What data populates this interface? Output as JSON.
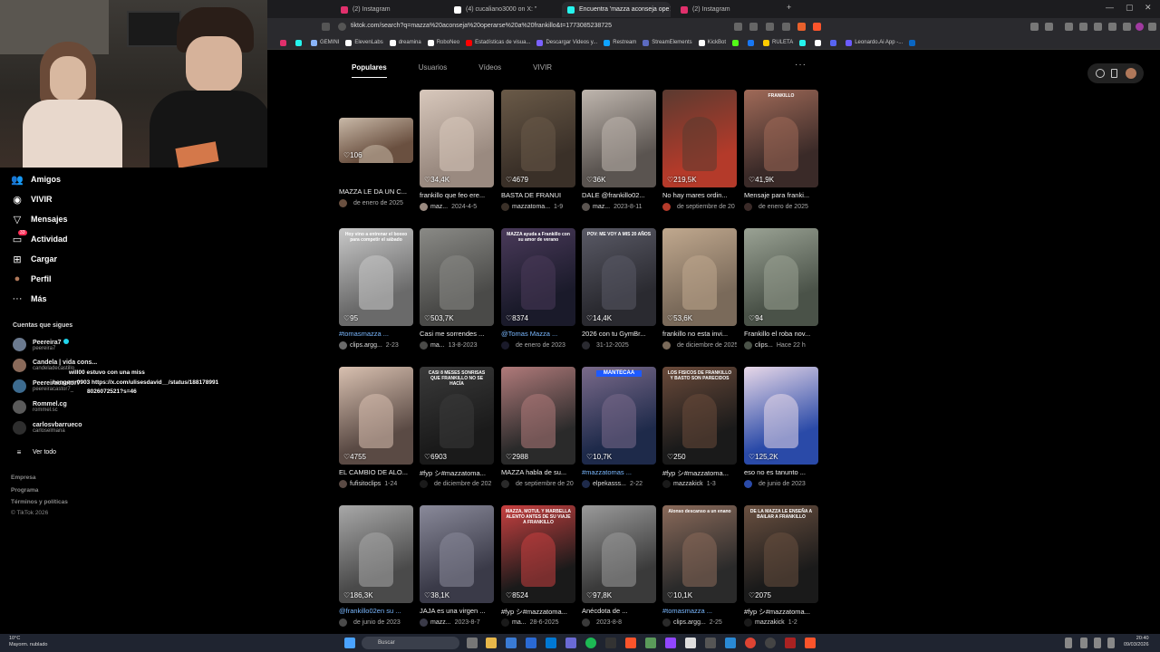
{
  "browser": {
    "tabs": [
      {
        "label": "(2) Instagram",
        "color": "#e1306c",
        "active": false
      },
      {
        "label": "(4) cucaliano3000 on X: \"",
        "color": "#ffffff",
        "active": false
      },
      {
        "label": "Encuentra 'mazza aconseja ope",
        "color": "#25f4ee",
        "active": true
      },
      {
        "label": "(2) Instagram",
        "color": "#e1306c",
        "active": false
      }
    ],
    "new_tab": "+",
    "url": "tiktok.com/search?q=mazza%20aconseja%20operarse%20a%20frankillo&t=1773085238725",
    "bookmarks": [
      {
        "label": "GEMINI",
        "color": "#8ab4f8"
      },
      {
        "label": "ElevenLabs",
        "color": "#ffffff"
      },
      {
        "label": "dreamina",
        "color": "#ffffff"
      },
      {
        "label": "RoboNeo",
        "color": "#ffffff"
      },
      {
        "label": "Estadísticas de visua...",
        "color": "#ff0000"
      },
      {
        "label": "Descargar Videos y...",
        "color": "#7b61ff"
      },
      {
        "label": "Restream",
        "color": "#0fa3ff"
      },
      {
        "label": "StreamElements",
        "color": "#5c6bc0"
      },
      {
        "label": "KickBot",
        "color": "#ffffff"
      },
      {
        "label": "RULETA",
        "color": "#ffcc00"
      },
      {
        "label": "Leonardo.Ai App -...",
        "color": "#6b5bff"
      }
    ]
  },
  "sidebar": {
    "items": [
      {
        "label": "Amigos",
        "icon": "friends-icon",
        "glyph": "👥"
      },
      {
        "label": "VIVIR",
        "icon": "live-icon",
        "glyph": "◉"
      },
      {
        "label": "Mensajes",
        "icon": "messages-icon",
        "glyph": "▽"
      },
      {
        "label": "Actividad",
        "icon": "activity-icon",
        "glyph": "▭"
      },
      {
        "label": "Cargar",
        "icon": "upload-icon",
        "glyph": "⊞"
      },
      {
        "label": "Perfil",
        "icon": "profile-icon",
        "glyph": "●"
      },
      {
        "label": "Más",
        "icon": "more-icon",
        "glyph": "···"
      }
    ],
    "actividad_badge": "33",
    "following_title": "Cuentas que sigues",
    "following": [
      {
        "name": "Peereira7",
        "handle": "peereira7",
        "verified": true,
        "color": "#6b7a8f"
      },
      {
        "name": "Candela | vida cons...",
        "handle": "candeladecastillo",
        "verified": false,
        "color": "#8a6a5a"
      },
      {
        "name": "Peereiracastor7",
        "handle": "peereiracastor7_",
        "verified": false,
        "color": "#3d6b8f"
      },
      {
        "name": "Rommel.cg",
        "handle": "rommel.sc",
        "verified": false,
        "color": "#5a5a5a"
      },
      {
        "name": "carlosvbarrueco",
        "handle": "carloselmana",
        "verified": false,
        "color": "#2e2e2e"
      }
    ],
    "see_all": "Ver todo",
    "footer": [
      "Empresa",
      "Programa",
      "Términos y políticas",
      "© TikTok 2026"
    ]
  },
  "chat_overlay": [
    "will00  estuvo con una miss",
    "hengerrr0903  https://x.com/ulisesdavid__/status/188178991",
    "8026072521?s=46"
  ],
  "content": {
    "tabs": [
      "Populares",
      "Usuarios",
      "Vídeos",
      "VIVIR"
    ],
    "active_tab": "Populares",
    "videos": [
      {
        "likes": "106",
        "desc": "MAZZA LE DA UN C...",
        "author": "",
        "date": "de enero de 2025",
        "c1": "#6a5040",
        "c2": "#c9b9a8",
        "overlay": "",
        "tag": false
      },
      {
        "likes": "34,4K",
        "desc": "frankillo que feo ere...",
        "author": "maz...",
        "date": "2024-4-5",
        "c1": "#9a8a80",
        "c2": "#d8c8bc",
        "overlay": "",
        "tag": false
      },
      {
        "likes": "4679",
        "desc": "BASTA DE FRANUI",
        "author": "mazzatoma...",
        "date": "1-9",
        "c1": "#3a3028",
        "c2": "#6a5a48",
        "overlay": "",
        "tag": false
      },
      {
        "likes": "36K",
        "desc": "DALE @frankillo02...",
        "author": "maz...",
        "date": "2023-8-11",
        "c1": "#5a5450",
        "c2": "#bfb6ae",
        "overlay": "",
        "tag": false
      },
      {
        "likes": "219,5K",
        "desc": "No hay mares ordin...",
        "author": "",
        "date": "de septiembre de 20",
        "c1": "#b43a2a",
        "c2": "#5a3a30",
        "overlay": "",
        "tag": false
      },
      {
        "likes": "41,9K",
        "desc": "Mensaje para franki...",
        "author": "",
        "date": "de enero de 2025",
        "c1": "#3a2a28",
        "c2": "#a06a58",
        "overlay": "FRANKILLO",
        "tag": false
      },
      {
        "likes": "95",
        "desc": "#tomasmazza ...",
        "author": "clips.argg...",
        "date": "2-23",
        "c1": "#6a6a6a",
        "c2": "#c8c8c8",
        "overlay": "Hoy vino a entrenar el boxeo para competir el sábado",
        "tag": true
      },
      {
        "likes": "503,7K",
        "desc": "Casi me sorrendes ...",
        "author": "ma...",
        "date": "13-8-2023",
        "c1": "#4a4a48",
        "c2": "#8a8a86",
        "overlay": "",
        "tag": false
      },
      {
        "likes": "8374",
        "desc": "@Tomas Mazza ...",
        "author": "",
        "date": "de enero de 2023",
        "c1": "#1a1a2a",
        "c2": "#4a3a5a",
        "overlay": "MAZZA ayuda a Frankillo con su amor de verano",
        "tag": true
      },
      {
        "likes": "14,4K",
        "desc": "2026 con tu GymBr...",
        "author": "",
        "date": "31-12-2025",
        "c1": "#2a2a30",
        "c2": "#5a5a66",
        "overlay": "POV: ME VOY A MIS 20 AÑOS",
        "tag": false
      },
      {
        "likes": "53,6K",
        "desc": "frankillo no esta invi...",
        "author": "",
        "date": "de diciembre de 2025",
        "c1": "#7a6a5a",
        "c2": "#c0a88e",
        "overlay": "",
        "tag": false
      },
      {
        "likes": "94",
        "desc": "Frankillo el roba nov...",
        "author": "clips...",
        "date": "Hace 22 h",
        "c1": "#4a5248",
        "c2": "#9aa294",
        "overlay": "",
        "tag": false
      },
      {
        "likes": "4755",
        "desc": "EL CAMBIO DE ALO...",
        "author": "fufisitoclips",
        "date": "1-24",
        "c1": "#5a4a44",
        "c2": "#d8c0b0",
        "overlay": "",
        "tag": false
      },
      {
        "likes": "6903",
        "desc": "#fyp シ#mazzatoma...",
        "author": "",
        "date": "de diciembre de 202",
        "c1": "#1a1a1a",
        "c2": "#3a3a3a",
        "overlay": "CASI 8 MESES SONRISAS QUE FRANKILLO NO SE HACÍA",
        "tag": false
      },
      {
        "likes": "2988",
        "desc": "MAZZA habla de su...",
        "author": "",
        "date": "de septiembre de 20",
        "c1": "#2a2a2a",
        "c2": "#b07a7a",
        "overlay": "",
        "tag": false
      },
      {
        "likes": "10,7K",
        "desc": "#mazzatomas ...",
        "author": "elpekasss...",
        "date": "2-22",
        "c1": "#1e2a4a",
        "c2": "#7a6a8a",
        "overlay": "MANTECAA",
        "tag": true
      },
      {
        "likes": "250",
        "desc": "#fyp シ#mazzatoma...",
        "author": "mazzakick",
        "date": "1-3",
        "c1": "#1a1a1a",
        "c2": "#6a4a3a",
        "overlay": "LOS FISICOS DE FRANKILLO Y BASTO SON PARECIDOS",
        "tag": false
      },
      {
        "likes": "125,2K",
        "desc": "eso no es tanunto ...",
        "author": "",
        "date": "de junio de 2023",
        "c1": "#2a4aa8",
        "c2": "#e8d8e8",
        "overlay": "",
        "tag": false
      },
      {
        "likes": "186,3K",
        "desc": "@frankillo02en su ...",
        "author": "",
        "date": "de junio de 2023",
        "c1": "#4a4a4a",
        "c2": "#a8a8a8",
        "overlay": "",
        "tag": true
      },
      {
        "likes": "38,1K",
        "desc": "JAJA es una virgen ...",
        "author": "mazz...",
        "date": "2023-8-7",
        "c1": "#3a3a48",
        "c2": "#8a8a9a",
        "overlay": "",
        "tag": false
      },
      {
        "likes": "8524",
        "desc": "#fyp シ#mazzatoma...",
        "author": "ma...",
        "date": "28-6-2025",
        "c1": "#1a1a1a",
        "c2": "#c84040",
        "overlay": "MAZZA, MOTUL Y MARBELLA ALENTO ANTES DE SU VIAJE A FRANKILLO",
        "tag": false
      },
      {
        "likes": "97,8K",
        "desc": "Anécdota de ...",
        "author": "",
        "date": "2023-8-8",
        "c1": "#3a3a3a",
        "c2": "#9a9a9a",
        "overlay": "",
        "tag": false
      },
      {
        "likes": "10,1K",
        "desc": "#tomasmazza ...",
        "author": "clips.argg...",
        "date": "2-25",
        "c1": "#2a2a2a",
        "c2": "#8a6a5a",
        "overlay": "Alonso descanso a un enano",
        "tag": true
      },
      {
        "likes": "2075",
        "desc": "#fyp シ#mazzatoma...",
        "author": "mazzakick",
        "date": "1-2",
        "c1": "#1a1a1a",
        "c2": "#6a5040",
        "overlay": "DE LA MAZZA LE ENSEÑA A BAILAR A FRANKILLO",
        "tag": false
      }
    ]
  },
  "taskbar": {
    "weather_temp": "10°C",
    "weather_desc": "Mayorm. nublado",
    "search_placeholder": "Buscar",
    "time": "20:40",
    "date": "09/03/2026"
  }
}
